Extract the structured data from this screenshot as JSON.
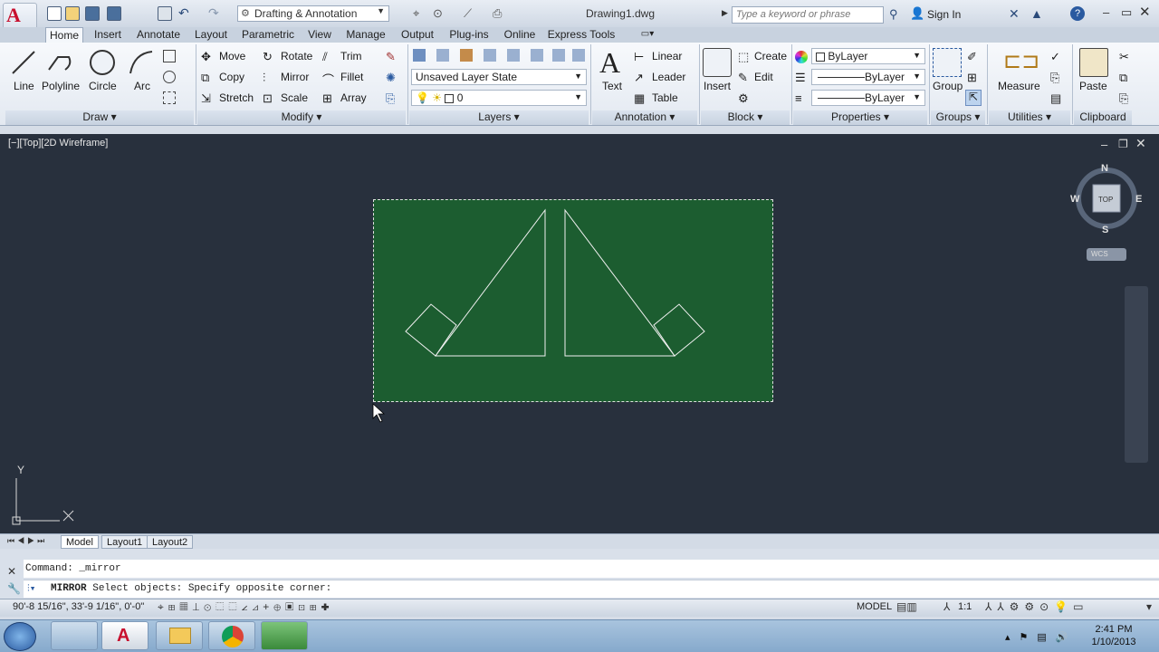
{
  "titlebar": {
    "workspace": "Drafting & Annotation",
    "document": "Drawing1.dwg",
    "search_placeholder": "Type a keyword or phrase",
    "sign_in": "Sign In"
  },
  "tabs": [
    "Home",
    "Insert",
    "Annotate",
    "Layout",
    "Parametric",
    "View",
    "Manage",
    "Output",
    "Plug-ins",
    "Online",
    "Express Tools"
  ],
  "draw": {
    "line": "Line",
    "polyline": "Polyline",
    "circle": "Circle",
    "arc": "Arc",
    "title": "Draw"
  },
  "modify": {
    "move": "Move",
    "rotate": "Rotate",
    "trim": "Trim",
    "copy": "Copy",
    "mirror": "Mirror",
    "fillet": "Fillet",
    "stretch": "Stretch",
    "scale": "Scale",
    "array": "Array",
    "title": "Modify"
  },
  "layers": {
    "state": "Unsaved Layer State",
    "current": "0",
    "title": "Layers"
  },
  "annotation": {
    "text": "Text",
    "linear": "Linear",
    "leader": "Leader",
    "table": "Table",
    "title": "Annotation"
  },
  "block": {
    "insert": "Insert",
    "create": "Create",
    "edit": "Edit",
    "title": "Block"
  },
  "properties": {
    "color": "ByLayer",
    "linetype": "ByLayer",
    "lineweight": "ByLayer",
    "title": "Properties"
  },
  "groups": {
    "group": "Group",
    "title": "Groups"
  },
  "utilities": {
    "measure": "Measure",
    "title": "Utilities"
  },
  "clipboard": {
    "paste": "Paste",
    "title": "Clipboard"
  },
  "viewport": {
    "label": "[−][Top][2D Wireframe]",
    "compass_n": "N",
    "compass_s": "S",
    "compass_e": "E",
    "compass_w": "W",
    "cube_top": "TOP",
    "wcs": "WCS",
    "ucs_y": "Y"
  },
  "layout_tabs": [
    "Model",
    "Layout1",
    "Layout2"
  ],
  "command": {
    "history": "Command: _mirror",
    "prompt_cmd": "MIRROR",
    "prompt": "Select objects: Specify opposite corner:"
  },
  "status": {
    "coords": "90'-8 15/16\", 33'-9 1/16\", 0'-0\"",
    "model": "MODEL",
    "scale": "1:1"
  },
  "taskbar": {
    "time": "2:41 PM",
    "date": "1/10/2013"
  }
}
